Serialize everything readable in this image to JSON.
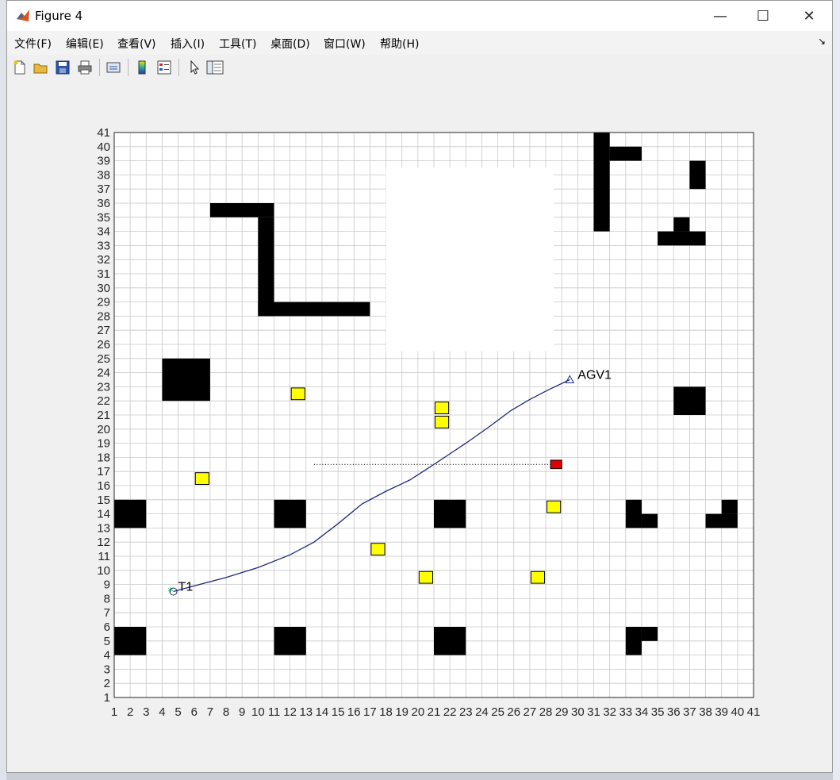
{
  "window": {
    "title": "Figure 4",
    "controls": {
      "minimize": "—",
      "maximize": "☐",
      "close": "✕"
    }
  },
  "menu": [
    {
      "label": "文件(F)"
    },
    {
      "label": "编辑(E)"
    },
    {
      "label": "查看(V)"
    },
    {
      "label": "插入(I)"
    },
    {
      "label": "工具(T)"
    },
    {
      "label": "桌面(D)"
    },
    {
      "label": "窗口(W)"
    },
    {
      "label": "帮助(H)"
    }
  ],
  "toolbar": [
    {
      "icon": "new-figure-icon"
    },
    {
      "icon": "open-file-icon"
    },
    {
      "icon": "save-icon"
    },
    {
      "icon": "print-icon"
    },
    {
      "icon": "link-plot-icon"
    },
    {
      "icon": "colorbar-icon"
    },
    {
      "icon": "legend-icon"
    },
    {
      "icon": "pointer-icon"
    },
    {
      "icon": "property-inspector-icon"
    }
  ],
  "chart_data": {
    "type": "grid-map",
    "xlim": [
      1,
      41
    ],
    "ylim": [
      1,
      41
    ],
    "xticks": [
      "1",
      "2",
      "3",
      "4",
      "5",
      "6",
      "7",
      "8",
      "9",
      "10",
      "11",
      "12",
      "13",
      "14",
      "15",
      "16",
      "17",
      "18",
      "19",
      "20",
      "21",
      "22",
      "23",
      "24",
      "25",
      "26",
      "27",
      "28",
      "29",
      "30",
      "31",
      "32",
      "33",
      "34",
      "35",
      "36",
      "37",
      "38",
      "39",
      "40",
      "41"
    ],
    "yticks": [
      "1",
      "2",
      "3",
      "4",
      "5",
      "6",
      "7",
      "8",
      "9",
      "10",
      "11",
      "12",
      "13",
      "14",
      "15",
      "16",
      "17",
      "18",
      "19",
      "20",
      "21",
      "22",
      "23",
      "24",
      "25",
      "26",
      "27",
      "28",
      "29",
      "30",
      "31",
      "32",
      "33",
      "34",
      "35",
      "36",
      "37",
      "38",
      "39",
      "40",
      "41"
    ],
    "grid": true,
    "obstacles": [
      {
        "x1": 4,
        "y1": 22,
        "x2": 7,
        "y2": 25
      },
      {
        "x1": 36,
        "y1": 21,
        "x2": 38,
        "y2": 23
      },
      {
        "x1": 7,
        "y1": 35,
        "x2": 11,
        "y2": 36
      },
      {
        "x1": 10,
        "y1": 28,
        "x2": 11,
        "y2": 35
      },
      {
        "x1": 10,
        "y1": 28,
        "x2": 17,
        "y2": 29
      },
      {
        "x1": 31,
        "y1": 34,
        "x2": 32,
        "y2": 41
      },
      {
        "x1": 32,
        "y1": 39,
        "x2": 34,
        "y2": 40
      },
      {
        "x1": 37,
        "y1": 37,
        "x2": 38,
        "y2": 39
      },
      {
        "x1": 35,
        "y1": 33,
        "x2": 38,
        "y2": 34
      },
      {
        "x1": 36,
        "y1": 34,
        "x2": 37,
        "y2": 35
      },
      {
        "x1": 1,
        "y1": 13,
        "x2": 3,
        "y2": 15
      },
      {
        "x1": 11,
        "y1": 13,
        "x2": 13,
        "y2": 15
      },
      {
        "x1": 21,
        "y1": 13,
        "x2": 23,
        "y2": 15
      },
      {
        "x1": 33,
        "y1": 13,
        "x2": 34,
        "y2": 15
      },
      {
        "x1": 34,
        "y1": 13,
        "x2": 35,
        "y2": 14
      },
      {
        "x1": 38,
        "y1": 13,
        "x2": 40,
        "y2": 14
      },
      {
        "x1": 39,
        "y1": 14,
        "x2": 40,
        "y2": 15
      },
      {
        "x1": 1,
        "y1": 4,
        "x2": 3,
        "y2": 6
      },
      {
        "x1": 11,
        "y1": 4,
        "x2": 13,
        "y2": 6
      },
      {
        "x1": 21,
        "y1": 4,
        "x2": 23,
        "y2": 6
      },
      {
        "x1": 33,
        "y1": 4,
        "x2": 34,
        "y2": 6
      },
      {
        "x1": 34,
        "y1": 5,
        "x2": 35,
        "y2": 6
      }
    ],
    "white_patch": {
      "x1": 18,
      "y1": 25.5,
      "x2": 28.5,
      "y2": 38.5
    },
    "yellow_cells": [
      {
        "x": 12,
        "y": 22
      },
      {
        "x": 21,
        "y": 21
      },
      {
        "x": 21,
        "y": 20
      },
      {
        "x": 6,
        "y": 16
      },
      {
        "x": 28,
        "y": 14
      },
      {
        "x": 17,
        "y": 11
      },
      {
        "x": 20,
        "y": 9
      },
      {
        "x": 27,
        "y": 9
      }
    ],
    "red_marker": {
      "x": 28.3,
      "y": 17.2,
      "w": 0.7,
      "h": 0.6
    },
    "dotted_line": {
      "x1": 13.5,
      "y": 17.5,
      "x2": 28.3
    },
    "path": [
      [
        4.7,
        8.5
      ],
      [
        6,
        8.9
      ],
      [
        8,
        9.5
      ],
      [
        10,
        10.2
      ],
      [
        12,
        11.1
      ],
      [
        13.5,
        12
      ],
      [
        15,
        13.3
      ],
      [
        16.5,
        14.7
      ],
      [
        18,
        15.6
      ],
      [
        19.5,
        16.4
      ],
      [
        21,
        17.5
      ],
      [
        21.8,
        18.1
      ],
      [
        23,
        19
      ],
      [
        24.5,
        20.2
      ],
      [
        25.8,
        21.3
      ],
      [
        27,
        22.1
      ],
      [
        28.2,
        22.8
      ],
      [
        29.5,
        23.5
      ]
    ],
    "start": {
      "x": 4.7,
      "y": 8.5,
      "label": "T1"
    },
    "agent": {
      "x": 29.5,
      "y": 23.5,
      "label": "AGV1"
    },
    "colors": {
      "obstacle": "#000000",
      "yellow": "#ffff00",
      "red": "#e00000",
      "path": "#1f2a7a",
      "start": "#00a050",
      "grid": "#c8c8c8"
    }
  }
}
